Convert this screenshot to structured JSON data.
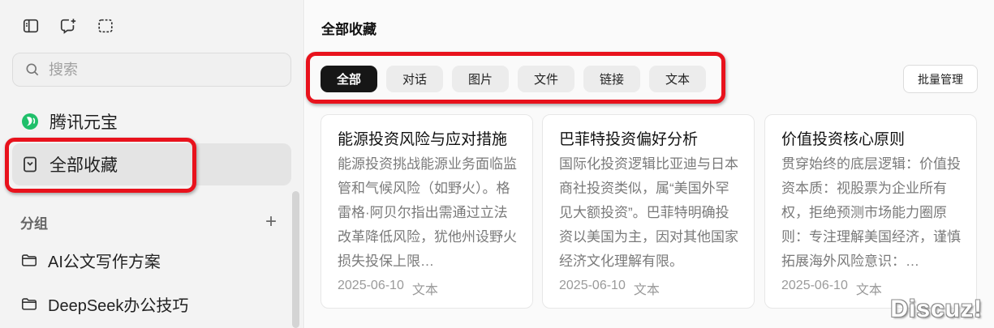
{
  "sidebar": {
    "search": {
      "placeholder": "搜索"
    },
    "assistant": {
      "label": "腾讯元宝"
    },
    "favorites": {
      "label": "全部收藏"
    },
    "groups": {
      "heading": "分组",
      "add": "+",
      "items": [
        {
          "label": "AI公文写作方案"
        },
        {
          "label": "DeepSeek办公技巧"
        }
      ]
    }
  },
  "main": {
    "title": "全部收藏",
    "filters": [
      {
        "label": "全部",
        "active": true
      },
      {
        "label": "对话",
        "active": false
      },
      {
        "label": "图片",
        "active": false
      },
      {
        "label": "文件",
        "active": false
      },
      {
        "label": "链接",
        "active": false
      },
      {
        "label": "文本",
        "active": false
      }
    ],
    "batch_label": "批量管理",
    "cards": [
      {
        "title": "能源投资风险与应对措施",
        "body": "能源投资挑战能源业务面临监管和气候风险（如野火）。格雷格·阿贝尔指出需通过立法改革降低风险，犹他州设野火损失投保上限…",
        "date": "2025-06-10",
        "type": "文本"
      },
      {
        "title": "巴菲特投资偏好分析",
        "body": "国际化投资逻辑比亚迪与日本商社投资类似，属“美国外罕见大额投资”。巴菲特明确投资以美国为主，因对其他国家经济文化理解有限。",
        "date": "2025-06-10",
        "type": "文本"
      },
      {
        "title": "价值投资核心原则",
        "body": "贯穿始终的底层逻辑：价值投资本质：视股票为企业所有权，拒绝预测市场能力圈原则：专注理解美国经济，谨慎拓展海外风险意识：…",
        "date": "2025-06-10",
        "type": "文本"
      }
    ]
  },
  "watermark": "Discuz!",
  "colors": {
    "highlight": "#e8121c",
    "active_chip": "#161616",
    "assistant_green": "#1fbf6a"
  }
}
